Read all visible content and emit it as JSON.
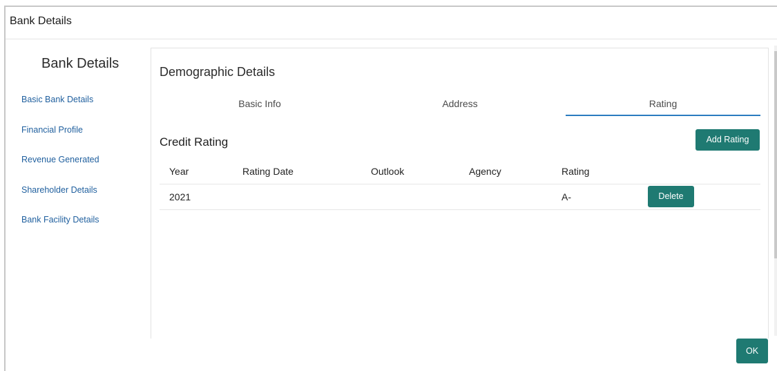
{
  "window": {
    "title": "Bank Details"
  },
  "sidebar": {
    "heading": "Bank Details",
    "items": [
      {
        "label": "Basic Bank Details"
      },
      {
        "label": "Financial Profile"
      },
      {
        "label": "Revenue Generated"
      },
      {
        "label": "Shareholder Details"
      },
      {
        "label": "Bank Facility Details"
      }
    ]
  },
  "main": {
    "section_title": "Demographic Details",
    "tabs": [
      {
        "label": "Basic Info",
        "active": false
      },
      {
        "label": "Address",
        "active": false
      },
      {
        "label": "Rating",
        "active": true
      }
    ],
    "credit": {
      "title": "Credit Rating",
      "add_button": "Add Rating",
      "columns": [
        "Year",
        "Rating Date",
        "Outlook",
        "Agency",
        "Rating"
      ],
      "rows": [
        {
          "year": "2021",
          "rating_date": "",
          "outlook": "",
          "agency": "",
          "rating": "A-",
          "action": "Delete"
        }
      ]
    }
  },
  "footer": {
    "ok_label": "OK"
  },
  "colors": {
    "accent_button": "#1f7a72",
    "link": "#1f5f9e",
    "active_tab_underline": "#2a7bbf"
  }
}
